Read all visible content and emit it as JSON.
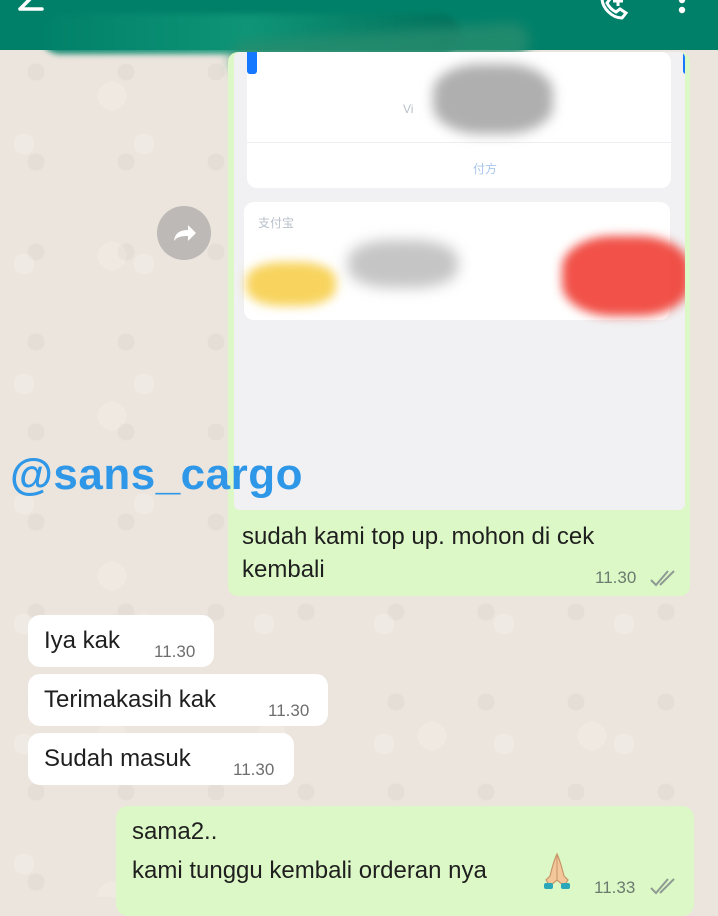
{
  "header": {
    "back_icon": "arrow-back-icon",
    "call_icon": "call-add-icon",
    "more_icon": "more-vert-icon",
    "background_color": "#008069"
  },
  "image_message": {
    "screenshot_faint_texts": [
      "Vi",
      "付方",
      "支付宝"
    ],
    "watermark": "@sans_cargo",
    "caption": "sudah kami top up. mohon di cek kembali",
    "caption_lines": [
      "sudah kami top up. mohon di cek",
      "kembali"
    ],
    "time": "11.30",
    "status_icon": "double-check-icon"
  },
  "forward_button": {
    "icon": "forward-icon"
  },
  "incoming": [
    {
      "text": "Iya kak",
      "time": "11.30"
    },
    {
      "text": "Terimakasih kak",
      "time": "11.30"
    },
    {
      "text": "Sudah masuk",
      "time": "11.30"
    }
  ],
  "outgoing_last": {
    "lines": [
      "sama2..",
      "kami tunggu kembali orderan nya"
    ],
    "emoji": "folded-hands-emoji",
    "time": "11.33",
    "status_icon": "double-check-icon"
  },
  "colors": {
    "outgoing_bubble": "#dcf8c6",
    "incoming_bubble": "#ffffff",
    "chat_background": "#ece5dd",
    "watermark": "#2f97e8"
  }
}
